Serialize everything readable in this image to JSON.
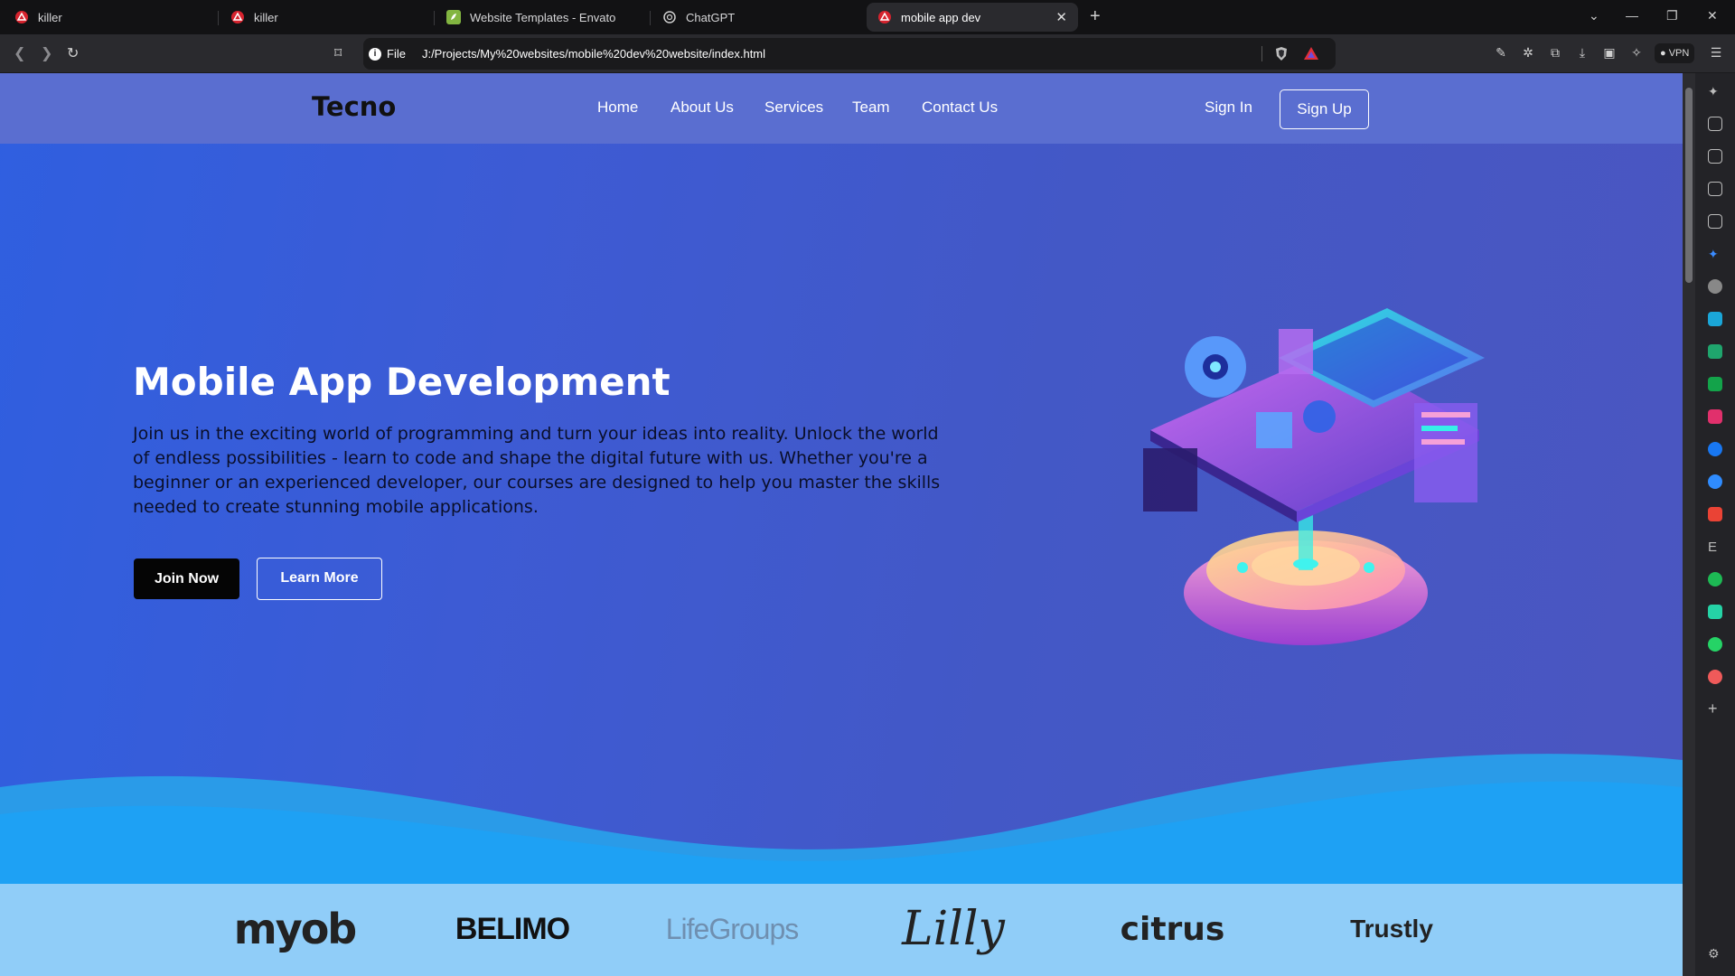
{
  "browser": {
    "tabs": [
      {
        "label": "killer",
        "active": false
      },
      {
        "label": "killer",
        "active": false
      },
      {
        "label": "Website Templates - Envato",
        "active": false
      },
      {
        "label": "ChatGPT",
        "active": false
      },
      {
        "label": "mobile app dev",
        "active": true
      }
    ],
    "new_tab_icon": "+",
    "url_scheme_label": "File",
    "url": "J:/Projects/My%20websites/mobile%20dev%20website/index.html",
    "vpn_label": "VPN"
  },
  "site": {
    "brand": "Tecno",
    "nav": [
      "Home",
      "About Us",
      "Services",
      "Team",
      "Contact Us"
    ],
    "sign_in": "Sign In",
    "sign_up": "Sign Up"
  },
  "hero": {
    "title": "Mobile App Development",
    "description": "Join us in the exciting world of programming and turn your ideas into reality. Unlock the world of endless possibilities - learn to code and shape the digital future with us. Whether you're a beginner or an experienced developer, our courses are designed to help you master the skills needed to create stunning mobile applications.",
    "primary_button": "Join Now",
    "secondary_button": "Learn More"
  },
  "clients": [
    "myob",
    "BELIMO",
    "LifeGroups",
    "Lilly",
    "citrus",
    "Trustly"
  ],
  "colors": {
    "nav_bg": "#5a6ed0",
    "hero_start": "#2f5fe0",
    "hero_end": "#4b56c0",
    "wave_light": "#29a6f5",
    "logo_strip": "#90cdf8"
  }
}
